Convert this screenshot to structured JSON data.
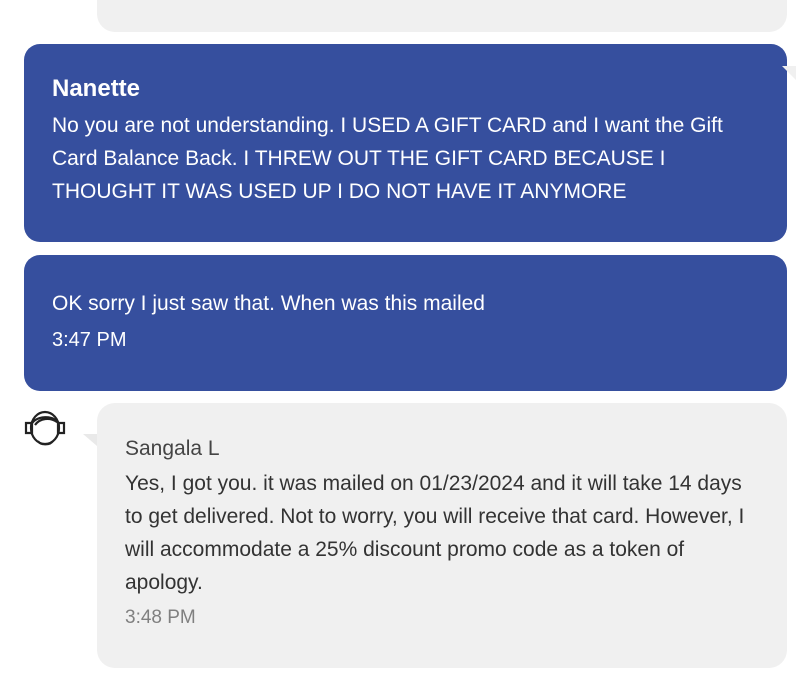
{
  "messages": [
    {
      "sender": "Nanette",
      "text": "No you are not understanding. I USED A GIFT CARD and I want the Gift Card Balance Back. I THREW OUT THE GIFT CARD BECAUSE I THOUGHT IT WAS USED UP I DO NOT HAVE IT ANYMORE"
    },
    {
      "text": "OK sorry I just saw that. When was this mailed",
      "time": "3:47 PM"
    },
    {
      "sender": "Sangala L",
      "text": "Yes, I got you. it was mailed on 01/23/2024 and it will take 14 days to get delivered. Not to worry, you will receive that card. However, I will accommodate a 25% discount promo code as a token of apology.",
      "time": "3:48 PM"
    }
  ],
  "colors": {
    "user_bubble": "#364f9e",
    "agent_bubble": "#f0f0f0"
  },
  "icons": {
    "agent_avatar": "agent-headset-icon"
  }
}
